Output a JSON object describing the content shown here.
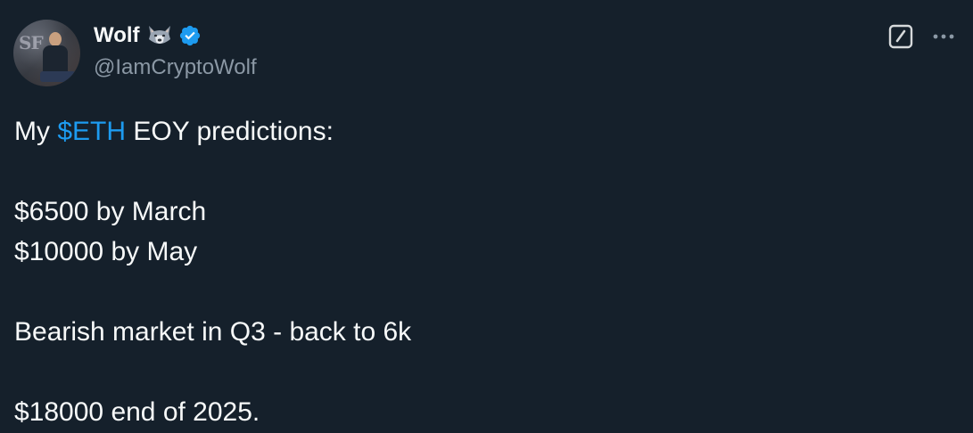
{
  "author": {
    "display_name": "Wolf",
    "handle": "@IamCryptoWolf",
    "verified": true,
    "emoji_icon": "wolf-emoji-icon",
    "avatar_icon": "profile-avatar"
  },
  "actions": {
    "grok_icon": "grok-icon",
    "more_icon": "more-dots-icon"
  },
  "tweet": {
    "line1_prefix": "My ",
    "cashtag": "$ETH",
    "line1_suffix": " EOY predictions:",
    "line2": "$6500 by March",
    "line3": "$10000 by May",
    "line4": "Bearish market in Q3 - back to 6k",
    "line5": "$18000 end of 2025."
  },
  "colors": {
    "background": "#15202b",
    "text_primary": "#f7f9f9",
    "text_secondary": "#8b98a5",
    "accent": "#1d9bf0"
  }
}
